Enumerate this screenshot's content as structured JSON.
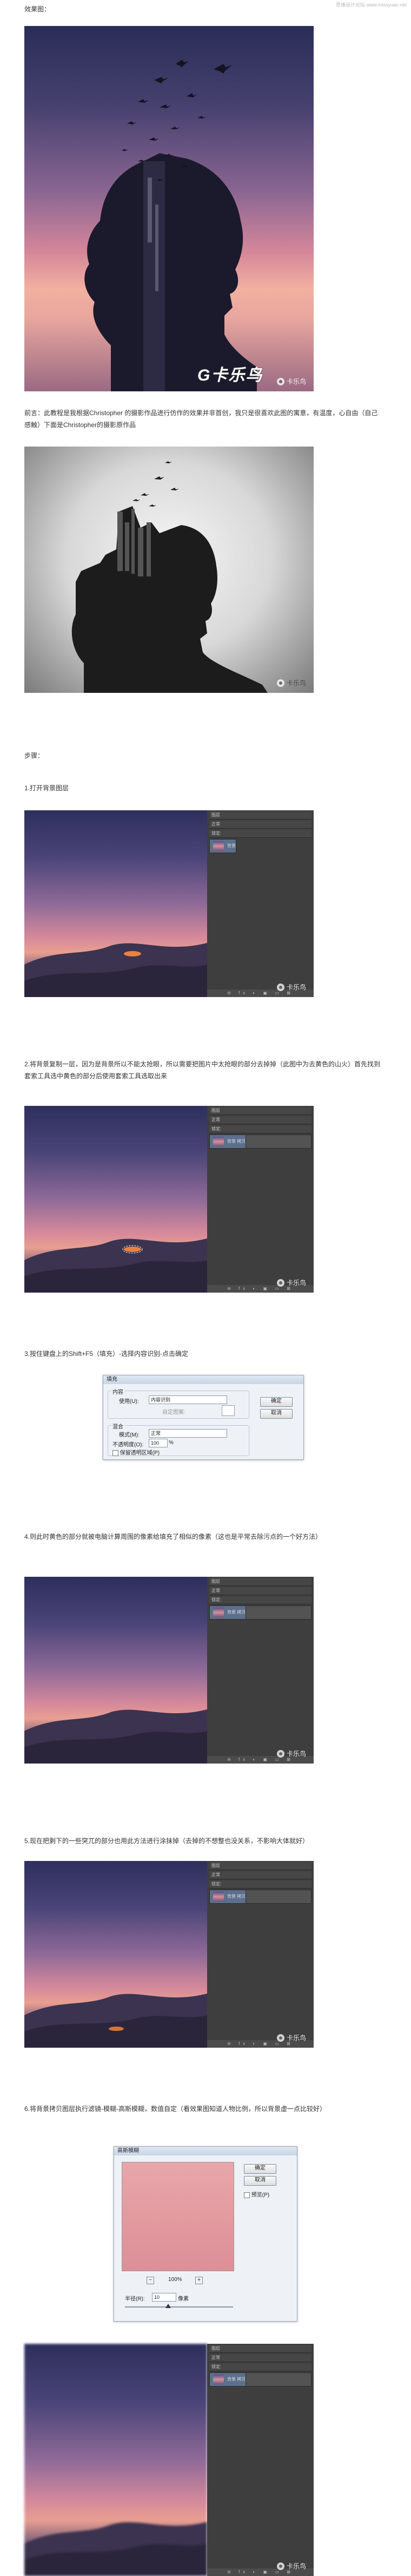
{
  "site_watermark": "思缘设计论坛  www.missyuan.net",
  "texts": {
    "intro_label": "效果图：",
    "preface": "前言：此教程是我根据Christopher 的摄影作品进行仿作的效果并非首创，我只是很喜欢此图的寓意，有温度，心自由（自己感触）下面是Christopher的摄影原作品",
    "steps_label": "步骤：",
    "step1": "1.打开背景图层",
    "step2": "2.将背景复制一层，因为是背景所以不能太抢眼，所以需要把图片中太抢眼的部分去掉掉（此图中为去黄色的山火）首先找到套索工具选中黄色的部分后使用套索工具选取出来",
    "step3": "3.按住键盘上的Shift+F5（填充）-选择内容识别-点击确定",
    "step4": "4.则此时黄色的部分就被电脑计算周围的像素给填充了相似的像素（这也是平常去除污点的一个好方法）",
    "step5": "5.现在把剩下的一些突兀的部分也用此方法进行涂抹掉（去掉的不想整也没关系，不影响大体就好）",
    "step6": "6.将背景拷贝图层执行滤镜-模糊-高斯模糊，数值自定（看效果图知道人物比例，所以背景虚一点比较好）"
  },
  "hero": {
    "title": "G卡乐鸟"
  },
  "watermark": {
    "text": "卡乐鸟"
  },
  "ps_panel": {
    "layers_single": [
      "背景"
    ],
    "layers_double": [
      "背景 拷贝",
      "背景"
    ],
    "tab": "图层",
    "mode": "正常",
    "opacity_label": "不透明度:",
    "lock_label": "锁定:",
    "fill_label": "填充:"
  },
  "fill_dialog": {
    "title": "填充",
    "content_legend": "内容",
    "use_label": "使用(U):",
    "use_value": "内容识别",
    "custom_pattern": "自定图案:",
    "blend_legend": "混合",
    "mode_label": "模式(M):",
    "mode_value": "正常",
    "opacity_label": "不透明度(O):",
    "opacity_value": "100",
    "opacity_unit": "%",
    "preserve_label": "保留透明区域(P)",
    "ok": "确定",
    "cancel": "取消"
  },
  "blur_dialog": {
    "title": "高斯模糊",
    "ok": "确定",
    "cancel": "取消",
    "preview": "预览(P)",
    "zoom": "100%",
    "radius_label": "半径(R):",
    "radius_value": "10",
    "radius_unit": "像素"
  }
}
